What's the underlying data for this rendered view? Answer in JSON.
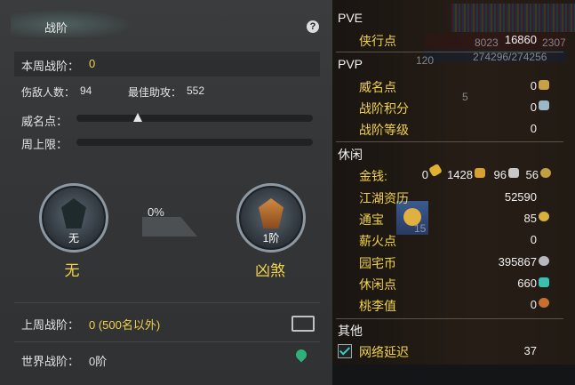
{
  "panel": {
    "title": "战阶",
    "help": "?",
    "weekly_label": "本周战阶：",
    "weekly_value": "0",
    "kills_label": "伤敌人数：",
    "kills_value": "94",
    "assist_label": "最佳助攻：",
    "assist_value": "552",
    "prestige_label": "威名点：",
    "cap_label": "周上限：",
    "progress_percent": "0%",
    "current_medal_level": "无",
    "current_rank": "无",
    "next_medal_level": "1阶",
    "next_rank": "凶煞",
    "last_week_label": "上周战阶：",
    "last_week_value": "0 (500名以外)",
    "world_label": "世界战阶：",
    "world_value": "0阶"
  },
  "stats": {
    "background_numbers": [
      "8023",
      "2307",
      "274296/274256",
      "120",
      "5",
      "15"
    ],
    "pve": {
      "heading": "PVE",
      "rows": [
        {
          "label": "侠行点",
          "value": "16860"
        }
      ]
    },
    "pvp": {
      "heading": "PVP",
      "rows": [
        {
          "label": "威名点",
          "value": "0"
        },
        {
          "label": "战阶积分",
          "value": "0"
        },
        {
          "label": "战阶等级",
          "value": "0"
        }
      ]
    },
    "leisure": {
      "heading": "休闲",
      "money_label": "金钱:",
      "money_gold": "0",
      "money_silver": "1428",
      "money_copper": "96",
      "money_coin": "56",
      "rows": [
        {
          "label": "江湖资历",
          "value": "52590"
        },
        {
          "label": "通宝",
          "value": "85"
        },
        {
          "label": "薪火点",
          "value": "0"
        },
        {
          "label": "园宅币",
          "value": "395867"
        },
        {
          "label": "休闲点",
          "value": "660"
        },
        {
          "label": "桃李值",
          "value": "0"
        }
      ]
    },
    "other": {
      "heading": "其他",
      "rows": [
        {
          "label": "网络延迟",
          "value": "37"
        }
      ]
    }
  }
}
